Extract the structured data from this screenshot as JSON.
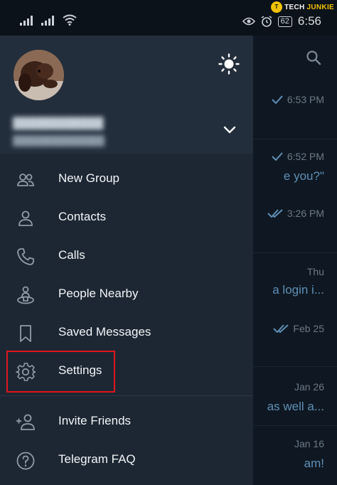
{
  "status_bar": {
    "time": "6:56",
    "battery": "62"
  },
  "watermark": {
    "logo_letter": "T",
    "tech": "TECH",
    "junkie": "JUNKIE"
  },
  "drawer": {
    "menu": [
      {
        "label": "New Group",
        "icon": "group-icon"
      },
      {
        "label": "Contacts",
        "icon": "contact-icon"
      },
      {
        "label": "Calls",
        "icon": "phone-icon"
      },
      {
        "label": "People Nearby",
        "icon": "people-nearby-icon"
      },
      {
        "label": "Saved Messages",
        "icon": "bookmark-icon"
      },
      {
        "label": "Settings",
        "icon": "gear-icon"
      },
      {
        "label": "Invite Friends",
        "icon": "add-person-icon"
      },
      {
        "label": "Telegram FAQ",
        "icon": "question-icon"
      }
    ]
  },
  "chats": [
    {
      "time": "6:53 PM",
      "ticks": "single",
      "snippet": ""
    },
    {
      "time": "6:52 PM",
      "ticks": "single",
      "snippet": "e you?\""
    },
    {
      "time": "3:26 PM",
      "ticks": "double",
      "snippet": ""
    },
    {
      "time": "Thu",
      "ticks": "none",
      "snippet": "a login i..."
    },
    {
      "time": "Feb 25",
      "ticks": "double",
      "snippet": ""
    },
    {
      "time": "Jan 26",
      "ticks": "none",
      "snippet": "as well a..."
    },
    {
      "time": "Jan 16",
      "ticks": "none",
      "snippet": "am!"
    }
  ],
  "colors": {
    "highlight": "#e0161d",
    "accent": "#5f8fb6",
    "drawer_bg": "#1d2733"
  }
}
